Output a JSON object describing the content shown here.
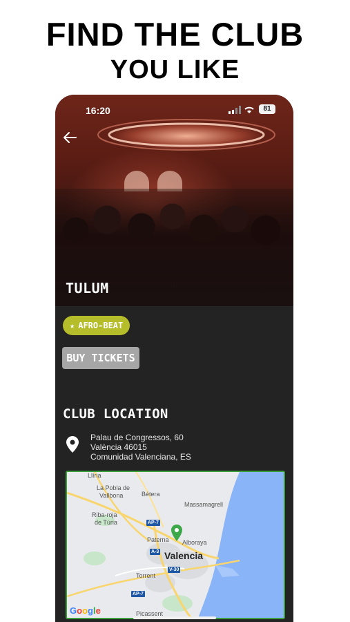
{
  "headline": {
    "line1": "FIND THE CLUB",
    "line2": "YOU LIKE"
  },
  "status_bar": {
    "time": "16:20",
    "battery": "81"
  },
  "club": {
    "name": "TULUM",
    "tag": "AFRO-BEAT",
    "buy_label": "BUY TICKETS"
  },
  "location": {
    "heading": "CLUB LOCATION",
    "address_line1": "Palau de Congressos, 60",
    "address_line2": "València 46015",
    "address_line3": "Comunidad Valenciana, ES"
  },
  "map": {
    "places": {
      "lliria": "Llíria",
      "la_pobla": "La Pobla de",
      "vallbona": "Vallbona",
      "betera": "Bétera",
      "massamagrell": "Massamagrell",
      "ribaroja": "Riba-roja",
      "de_turia": "de Túria",
      "paterna": "Paterna",
      "alboraya": "Alboraya",
      "valencia": "Valencia",
      "torrent": "Torrent",
      "picassent": "Picassent"
    },
    "roads": {
      "ap7_a": "AP-7",
      "a3": "A-3",
      "v30": "V-30",
      "ap7_b": "AP-7"
    },
    "google": "Google"
  },
  "colors": {
    "tag_bg": "#b6bd2a",
    "map_border": "#3d9e3d",
    "pin": "#3da84a"
  },
  "icons": {
    "back": "arrow-left-icon",
    "location": "location-pin-icon",
    "map_marker": "map-marker-icon",
    "star": "star-icon"
  }
}
